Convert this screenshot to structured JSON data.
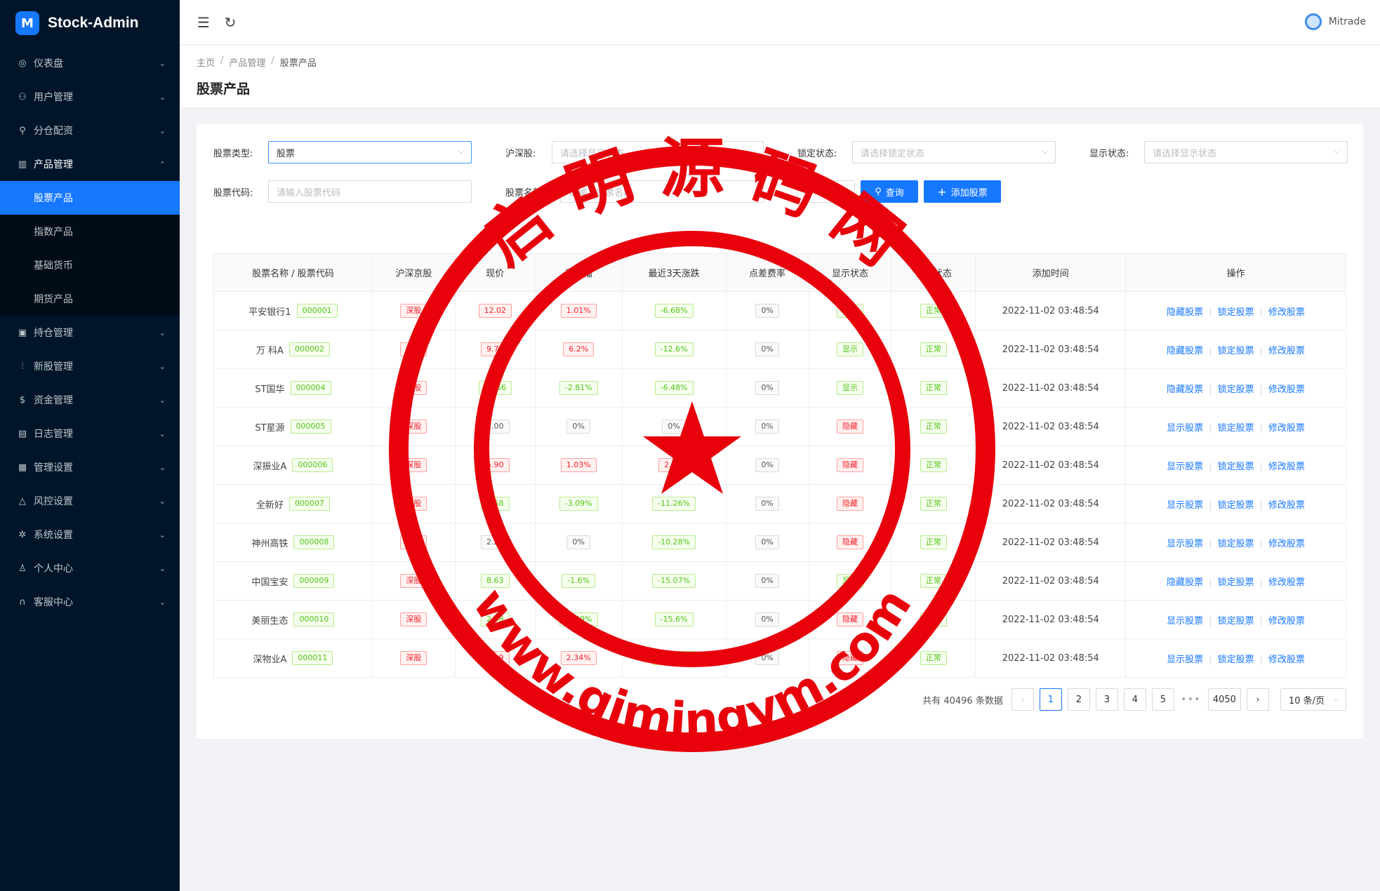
{
  "app": {
    "name": "Stock-Admin",
    "logo_letter": "M"
  },
  "sidebar": {
    "items": [
      {
        "label": "仪表盘",
        "icon": "dashboard-icon",
        "glyph": "◎"
      },
      {
        "label": "用户管理",
        "icon": "users-icon",
        "glyph": "⚇"
      },
      {
        "label": "分仓配资",
        "icon": "cluster-icon",
        "glyph": "⚲"
      },
      {
        "label": "产品管理",
        "icon": "chart-icon",
        "glyph": "▥",
        "open": true,
        "children": [
          {
            "label": "股票产品",
            "active": true
          },
          {
            "label": "指数产品"
          },
          {
            "label": "基础货币"
          },
          {
            "label": "期货产品"
          }
        ]
      },
      {
        "label": "持仓管理",
        "icon": "position-icon",
        "glyph": "▣"
      },
      {
        "label": "新股管理",
        "icon": "ipo-icon",
        "glyph": "⫶"
      },
      {
        "label": "资金管理",
        "icon": "money-icon",
        "glyph": "$"
      },
      {
        "label": "日志管理",
        "icon": "log-icon",
        "glyph": "▤"
      },
      {
        "label": "管理设置",
        "icon": "admin-icon",
        "glyph": "▦"
      },
      {
        "label": "风控设置",
        "icon": "warning-icon",
        "glyph": "△"
      },
      {
        "label": "系统设置",
        "icon": "gear-icon",
        "glyph": "✲"
      },
      {
        "label": "个人中心",
        "icon": "user-icon",
        "glyph": "♙"
      },
      {
        "label": "客服中心",
        "icon": "headset-icon",
        "glyph": "∩"
      }
    ]
  },
  "header": {
    "user_name": "Mitrade"
  },
  "breadcrumb": {
    "home": "主页",
    "section": "产品管理",
    "current": "股票产品"
  },
  "page_title": "股票产品",
  "filters": {
    "stock_type_label": "股票类型:",
    "stock_type_value": "股票",
    "market_label": "沪深股:",
    "market_placeholder": "请选择显示状态",
    "lock_label": "锁定状态:",
    "lock_placeholder": "请选择锁定状态",
    "show_label": "显示状态:",
    "show_placeholder": "请选择显示状态",
    "code_label": "股票代码:",
    "code_placeholder": "请输入股票代码",
    "name_label": "股票名称:",
    "name_placeholder": "请输入股票名称",
    "reset": "重置",
    "search": "查询",
    "add": "添加股票"
  },
  "table": {
    "headers": [
      "股票名称 / 股票代码",
      "沪深京股",
      "现价",
      "涨跌幅",
      "最近3天涨跌",
      "点差费率",
      "显示状态",
      "锁定状态",
      "添加时间",
      "操作"
    ],
    "rows": [
      {
        "name": "平安银行1",
        "code": "000001",
        "market": "深股",
        "price": "12.02",
        "price_dir": "red",
        "change": "1.01%",
        "change_dir": "red",
        "change3": "-6.68%",
        "change3_dir": "green",
        "fee": "0%",
        "show": "显示",
        "show_dir": "green",
        "lock": "正常",
        "time": "2022-11-02 03:48:54",
        "op1": "隐藏股票",
        "op2": "锁定股票",
        "op3": "修改股票"
      },
      {
        "name": "万 科A",
        "code": "000002",
        "market": "深股",
        "price": "9.77",
        "price_dir": "red",
        "change": "6.2%",
        "change_dir": "red",
        "change3": "-12.6%",
        "change3_dir": "green",
        "fee": "0%",
        "show": "显示",
        "show_dir": "green",
        "lock": "正常",
        "time": "2022-11-02 03:48:54",
        "op1": "隐藏股票",
        "op2": "锁定股票",
        "op3": "修改股票"
      },
      {
        "name": "ST国华",
        "code": "000004",
        "market": "深股",
        "price": "13.56",
        "price_dir": "green",
        "change": "-2.81%",
        "change_dir": "green",
        "change3": "-6.48%",
        "change3_dir": "green",
        "fee": "0%",
        "show": "显示",
        "show_dir": "green",
        "lock": "正常",
        "time": "2022-11-02 03:48:54",
        "op1": "隐藏股票",
        "op2": "锁定股票",
        "op3": "修改股票"
      },
      {
        "name": "ST星源",
        "code": "000005",
        "market": "深股",
        "price": "2.00",
        "price_dir": "grey",
        "change": "0%",
        "change_dir": "grey",
        "change3": "0%",
        "change3_dir": "grey",
        "fee": "0%",
        "show": "隐藏",
        "show_dir": "red",
        "lock": "正常",
        "time": "2022-11-02 03:48:54",
        "op1": "显示股票",
        "op2": "锁定股票",
        "op3": "修改股票"
      },
      {
        "name": "深振业A",
        "code": "000006",
        "market": "深股",
        "price": "5.90",
        "price_dir": "red",
        "change": "1.03%",
        "change_dir": "red",
        "change3": "2.1%",
        "change3_dir": "red",
        "fee": "0%",
        "show": "隐藏",
        "show_dir": "red",
        "lock": "正常",
        "time": "2022-11-02 03:48:54",
        "op1": "显示股票",
        "op2": "锁定股票",
        "op3": "修改股票"
      },
      {
        "name": "全新好",
        "code": "000007",
        "market": "深股",
        "price": "6.58",
        "price_dir": "green",
        "change": "-3.09%",
        "change_dir": "green",
        "change3": "-11.26%",
        "change3_dir": "green",
        "fee": "0%",
        "show": "隐藏",
        "show_dir": "red",
        "lock": "正常",
        "time": "2022-11-02 03:48:54",
        "op1": "显示股票",
        "op2": "锁定股票",
        "op3": "修改股票"
      },
      {
        "name": "神州高铁",
        "code": "000008",
        "market": "深股",
        "price": "2.25",
        "price_dir": "grey",
        "change": "0%",
        "change_dir": "grey",
        "change3": "-10.28%",
        "change3_dir": "green",
        "fee": "0%",
        "show": "隐藏",
        "show_dir": "red",
        "lock": "正常",
        "time": "2022-11-02 03:48:54",
        "op1": "显示股票",
        "op2": "锁定股票",
        "op3": "修改股票"
      },
      {
        "name": "中国宝安",
        "code": "000009",
        "market": "深股",
        "price": "8.63",
        "price_dir": "green",
        "change": "-1.6%",
        "change_dir": "green",
        "change3": "-15.07%",
        "change3_dir": "green",
        "fee": "0%",
        "show": "显示",
        "show_dir": "green",
        "lock": "正常",
        "time": "2022-11-02 03:48:54",
        "op1": "隐藏股票",
        "op2": "锁定股票",
        "op3": "修改股票"
      },
      {
        "name": "美丽生态",
        "code": "000010",
        "market": "深股",
        "price": "2.98",
        "price_dir": "green",
        "change": "-1.49%",
        "change_dir": "green",
        "change3": "-15.6%",
        "change3_dir": "green",
        "fee": "0%",
        "show": "隐藏",
        "show_dir": "red",
        "lock": "正常",
        "time": "2022-11-02 03:48:54",
        "op1": "显示股票",
        "op2": "锁定股票",
        "op3": "修改股票"
      },
      {
        "name": "深物业A",
        "code": "000011",
        "market": "深股",
        "price": "9.19",
        "price_dir": "red",
        "change": "2.34%",
        "change_dir": "red",
        "change3": "-10.23%",
        "change3_dir": "green",
        "fee": "0%",
        "show": "隐藏",
        "show_dir": "red",
        "lock": "正常",
        "time": "2022-11-02 03:48:54",
        "op1": "显示股票",
        "op2": "锁定股票",
        "op3": "修改股票"
      }
    ]
  },
  "pagination": {
    "total_text": "共有 40496 条数据",
    "pages": [
      "1",
      "2",
      "3",
      "4",
      "5"
    ],
    "current": "1",
    "last": "4050",
    "ellipsis": "•••",
    "page_size": "10 条/页",
    "prev": "‹",
    "next": "›"
  },
  "watermark": {
    "top_text": "启 明 源 码 网",
    "bottom_text": "www.qimingym.com",
    "color": "#e8000b"
  }
}
